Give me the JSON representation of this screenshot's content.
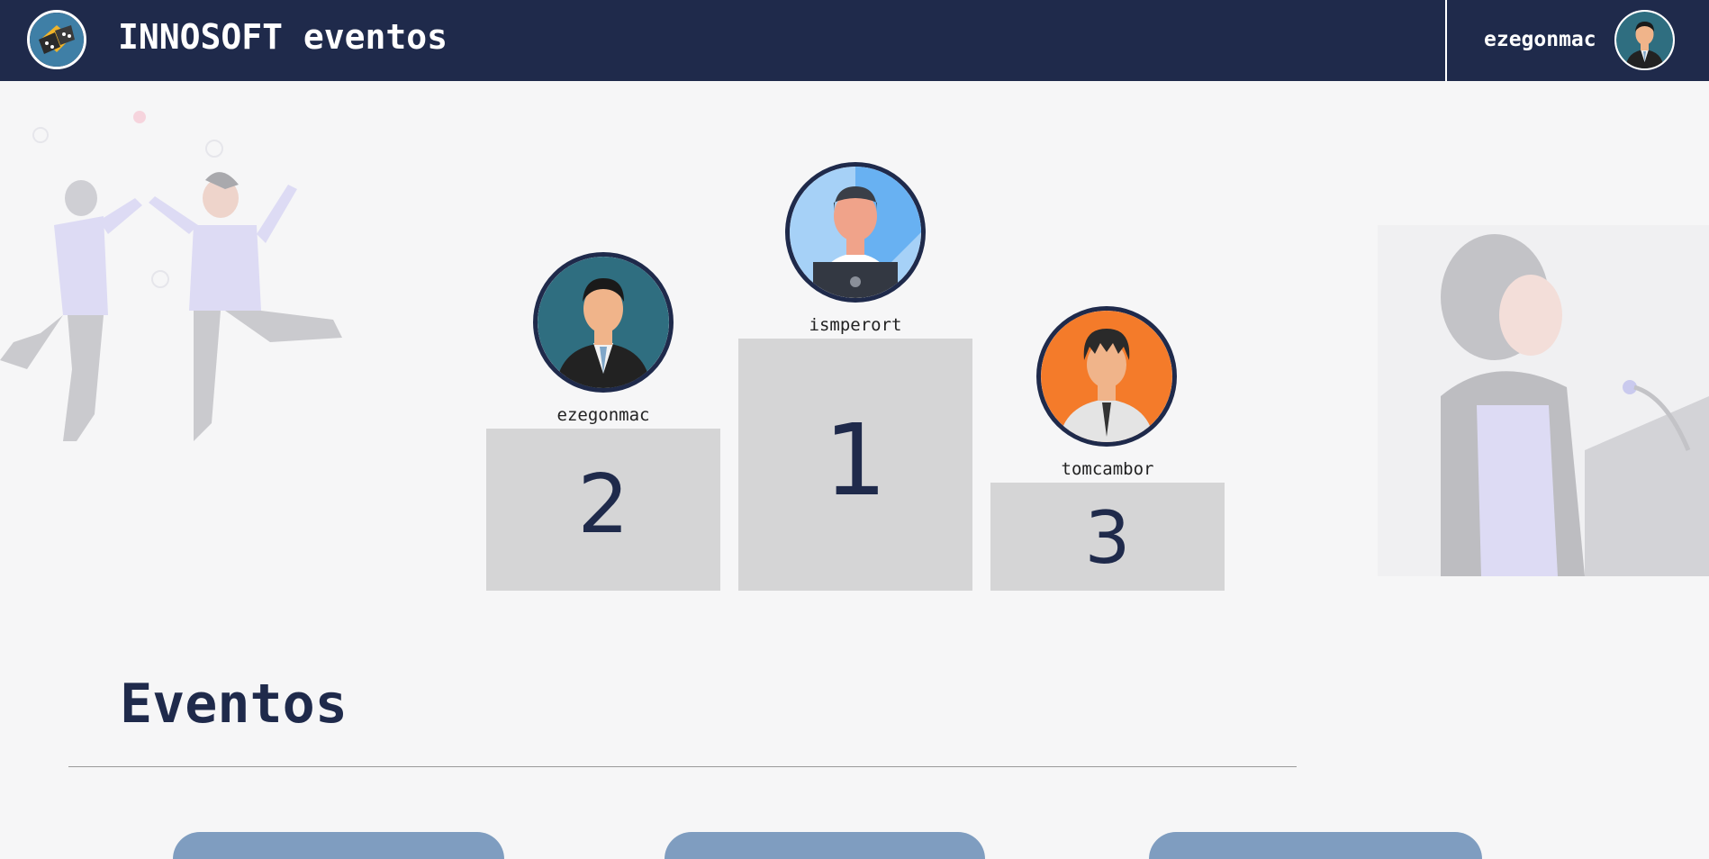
{
  "header": {
    "app_title": "INNOSOFT eventos",
    "logo_icon": "dice-logo-icon",
    "user_name": "ezegonmac",
    "user_avatar_icon": "businessman-avatar-icon"
  },
  "podium": {
    "first": {
      "place": "1",
      "username": "ismperort",
      "avatar_icon": "laptop-user-avatar-icon"
    },
    "second": {
      "place": "2",
      "username": "ezegonmac",
      "avatar_icon": "businessman-avatar-icon"
    },
    "third": {
      "place": "3",
      "username": "tomcambor",
      "avatar_icon": "office-worker-avatar-icon"
    }
  },
  "events_section": {
    "title": "Eventos"
  },
  "colors": {
    "navy": "#1f2a4b",
    "background": "#f6f6f7",
    "podium_block": "#d5d5d6",
    "card_blue": "#7f9dc0"
  }
}
